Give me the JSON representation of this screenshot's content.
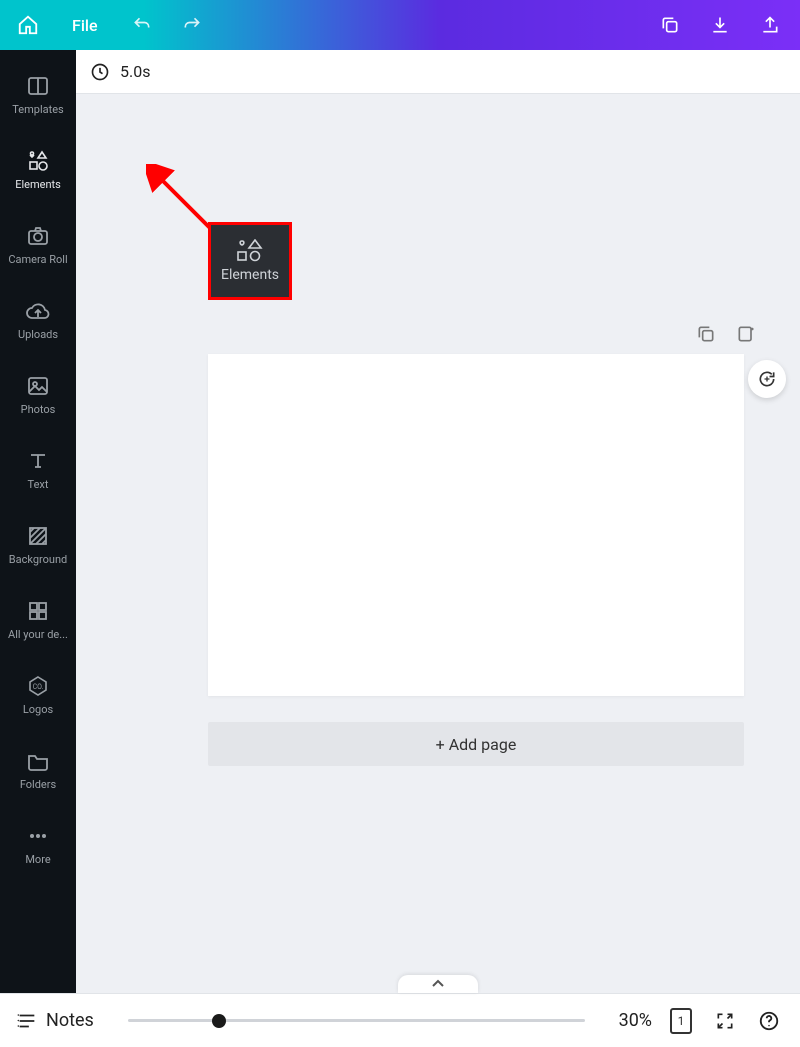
{
  "topbar": {
    "file_label": "File"
  },
  "sidebar": {
    "items": [
      {
        "label": "Templates"
      },
      {
        "label": "Elements"
      },
      {
        "label": "Camera Roll"
      },
      {
        "label": "Uploads"
      },
      {
        "label": "Photos"
      },
      {
        "label": "Text"
      },
      {
        "label": "Background"
      },
      {
        "label": "All your de..."
      },
      {
        "label": "Logos"
      },
      {
        "label": "Folders"
      },
      {
        "label": "More"
      }
    ]
  },
  "timebar": {
    "duration": "5.0s"
  },
  "annotation": {
    "label": "Elements"
  },
  "canvas": {
    "add_page_label": "+ Add page"
  },
  "footer": {
    "notes_label": "Notes",
    "zoom_label": "30%",
    "page_number": "1"
  }
}
